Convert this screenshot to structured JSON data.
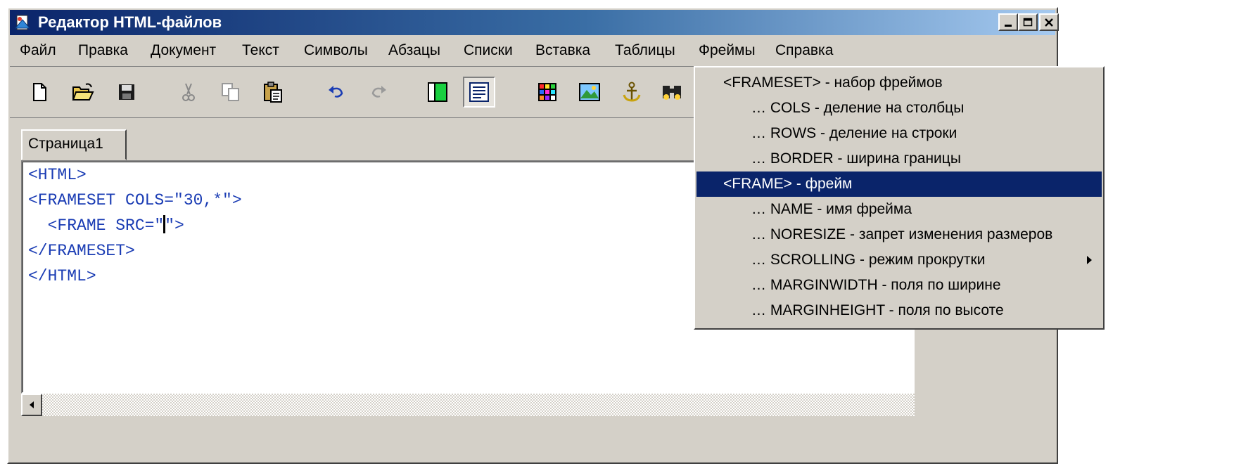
{
  "window": {
    "title": "Редактор HTML-файлов",
    "controls": {
      "minimize": "_",
      "maximize": "□",
      "close": "×"
    }
  },
  "menubar": {
    "items": [
      "Файл",
      "Правка",
      "Документ",
      "Текст",
      "Символы",
      "Абзацы",
      "Списки",
      "Вставка",
      "Таблицы",
      "Фреймы",
      "Справка"
    ]
  },
  "toolbar": {
    "buttons": [
      "new-file-icon",
      "open-folder-icon",
      "save-disk-icon",
      "cut-scissors-icon",
      "copy-icon",
      "paste-icon",
      "undo-icon",
      "redo-icon",
      "frame-view-icon",
      "text-view-icon",
      "table-grid-icon",
      "image-icon",
      "anchor-icon",
      "find-binoculars-icon"
    ],
    "pressed": "text-view-icon"
  },
  "tabs": {
    "items": [
      "Страница1"
    ]
  },
  "editor": {
    "lines": [
      "<HTML>",
      "<FRAMESET COLS=\"30,*\">",
      "  <FRAME SRC=\"",
      "\">",
      "</FRAMESET>",
      "</HTML>"
    ]
  },
  "frames_menu": {
    "items": [
      "<FRAMESET> - набор фреймов",
      "… COLS - деление на столбцы",
      "… ROWS - деление на строки",
      "… BORDER - ширина границы",
      "<FRAME> - фрейм",
      "… NAME - имя фрейма",
      "… NORESIZE - запрет изменения размеров",
      "… SCROLLING - режим прокрутки",
      "… MARGINWIDTH - поля по ширине",
      "… MARGINHEIGHT - поля по высоте"
    ],
    "highlighted_item": "<FRAME> - фрейм",
    "submenu_item": "… SCROLLING - режим прокрутки"
  },
  "colors": {
    "title_bar": "#0a246a",
    "menu_highlight": "#0a246a",
    "code_text": "#1a3cb4",
    "chrome": "#d4d0c8"
  }
}
